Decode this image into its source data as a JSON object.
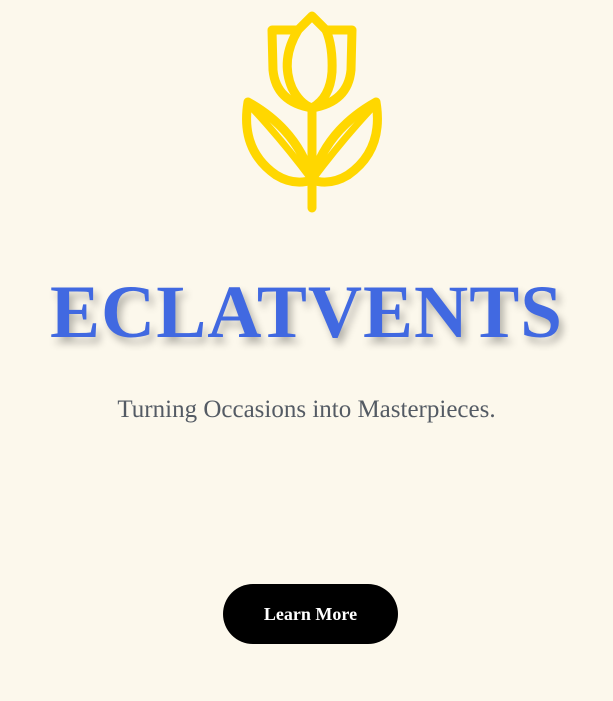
{
  "brand": {
    "logo_icon": "tulip-icon",
    "logo_color": "#ffd700",
    "title": "ECLATVENTS",
    "title_color": "#4169e1",
    "tagline": "Turning Occasions into Masterpieces."
  },
  "cta": {
    "label": "Learn More",
    "background": "#000000",
    "text_color": "#ffffff"
  },
  "page": {
    "background": "#fcf8ec"
  }
}
